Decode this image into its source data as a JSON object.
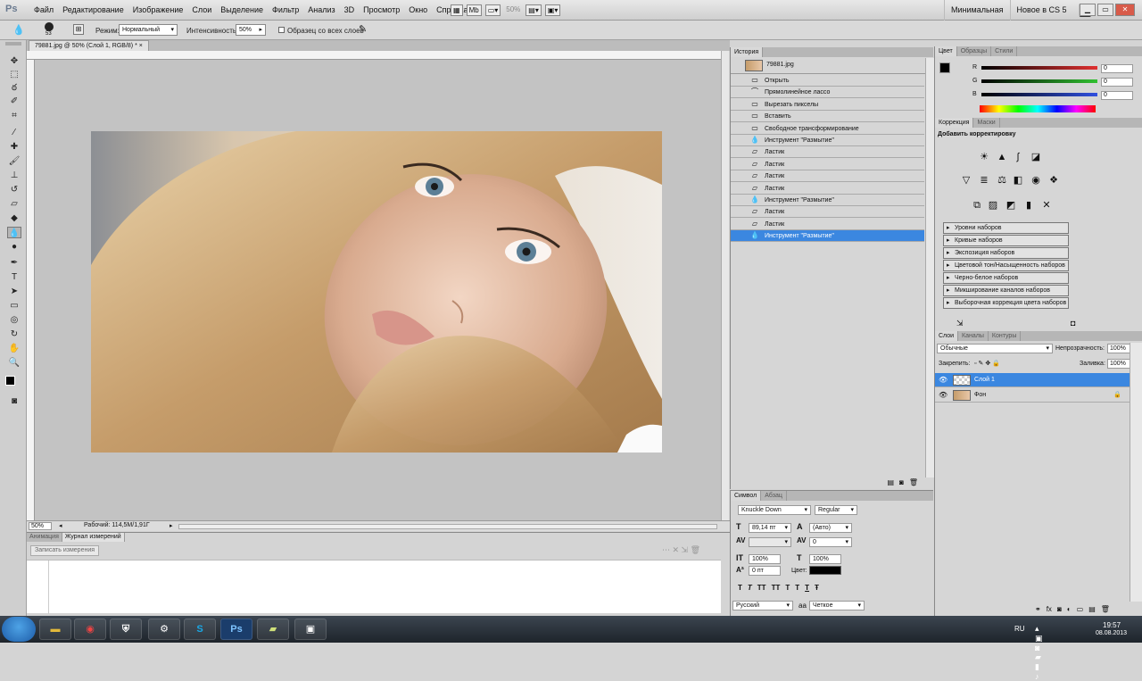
{
  "menubar": {
    "logo": "Ps",
    "items": [
      "Файл",
      "Редактирование",
      "Изображение",
      "Слои",
      "Выделение",
      "Фильтр",
      "Анализ",
      "3D",
      "Просмотр",
      "Окно",
      "Справка"
    ],
    "zoom": "50%",
    "workspaces": [
      "Минимальная",
      "Новое в CS 5"
    ]
  },
  "options": {
    "brush_size": "53",
    "mode_label": "Режим:",
    "mode_value": "Нормальный",
    "intensity_label": "Интенсивность:",
    "intensity_value": "50%",
    "sample_all_label": "Образец со всех слоев"
  },
  "document": {
    "tab_title": "79881.jpg @ 50% (Слой 1, RGB/8) *",
    "status_zoom": "50%",
    "status_info": "Рабочий: 114,5M/1,91Г"
  },
  "measure_panel": {
    "tabs": [
      "Анимация",
      "Журнал измерений"
    ],
    "button": "Записать измерения"
  },
  "history": {
    "tab": "История",
    "snapshot": "79881.jpg",
    "items": [
      {
        "icon": "doc-icon",
        "label": "Открыть"
      },
      {
        "icon": "lasso-icon",
        "label": "Прямолинейное лассо"
      },
      {
        "icon": "doc-icon",
        "label": "Вырезать пикселы"
      },
      {
        "icon": "doc-icon",
        "label": "Вставить"
      },
      {
        "icon": "doc-icon",
        "label": "Свободное трансформирование"
      },
      {
        "icon": "blur-icon",
        "label": "Инструмент \"Размытие\""
      },
      {
        "icon": "eraser-icon",
        "label": "Ластик"
      },
      {
        "icon": "eraser-icon",
        "label": "Ластик"
      },
      {
        "icon": "eraser-icon",
        "label": "Ластик"
      },
      {
        "icon": "eraser-icon",
        "label": "Ластик"
      },
      {
        "icon": "blur-icon",
        "label": "Инструмент \"Размытие\""
      },
      {
        "icon": "eraser-icon",
        "label": "Ластик"
      },
      {
        "icon": "eraser-icon",
        "label": "Ластик"
      },
      {
        "icon": "blur-icon",
        "label": "Инструмент \"Размытие\""
      }
    ],
    "selected_index": 13
  },
  "character": {
    "tabs": [
      "Символ",
      "Абзац"
    ],
    "font": "Knuckle Down",
    "style": "Regular",
    "size": "89,14 пт",
    "leading": "(Авто)",
    "tracking": "0",
    "vscale": "100%",
    "hscale": "100%",
    "baseline": "0 пт",
    "color_label": "Цвет:",
    "style_buttons": [
      "T",
      "T",
      "TT",
      "TT",
      "T",
      "T",
      "T",
      "Ŧ"
    ],
    "language": "Русский",
    "aa_label": "aa",
    "antialias": "Четкое"
  },
  "color_panel": {
    "tabs": [
      "Цвет",
      "Образцы",
      "Стили"
    ],
    "channels": [
      {
        "label": "R",
        "value": "0",
        "color": "#e03030"
      },
      {
        "label": "G",
        "value": "0",
        "color": "#30c030"
      },
      {
        "label": "B",
        "value": "0",
        "color": "#3050e0"
      }
    ]
  },
  "adjustments": {
    "tabs": [
      "Коррекция",
      "Маски"
    ],
    "title": "Добавить корректировку",
    "presets": [
      "Уровни наборов",
      "Кривые наборов",
      "Экспозиция наборов",
      "Цветовой тон/Насыщенность наборов",
      "Черно-белое наборов",
      "Микширование каналов наборов",
      "Выборочная коррекция цвета наборов"
    ]
  },
  "layers": {
    "tabs": [
      "Слои",
      "Каналы",
      "Контуры"
    ],
    "blend": "Обычные",
    "opacity_label": "Непрозрачность:",
    "opacity": "100%",
    "lock_label": "Закрепить:",
    "fill_label": "Заливка:",
    "fill": "100%",
    "items": [
      {
        "name": "Слой 1",
        "selected": true
      },
      {
        "name": "Фон",
        "selected": false
      }
    ]
  },
  "taskbar": {
    "lang": "RU",
    "time": "19:57",
    "date": "08.08.2013"
  }
}
